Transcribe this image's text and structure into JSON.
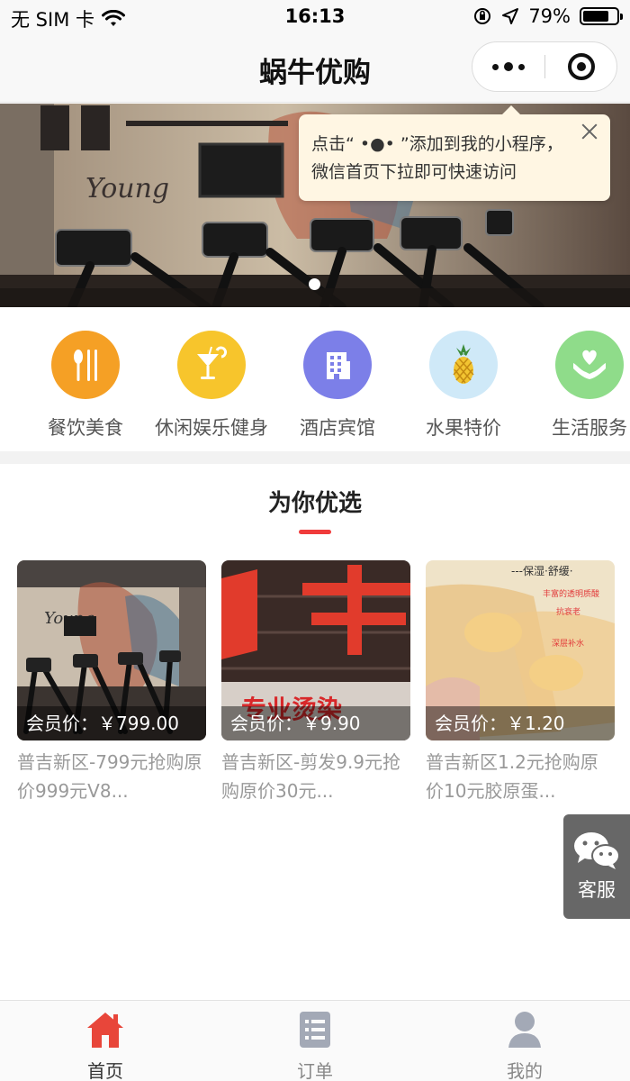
{
  "status_bar": {
    "carrier": "无 SIM 卡",
    "time": "16:13",
    "battery_text": "79%",
    "battery_level": 0.79
  },
  "nav": {
    "title": "蜗牛优购"
  },
  "banner": {
    "image": "gym-treadmills-photo",
    "slide_index": 1
  },
  "tooltip": {
    "line1": "点击“ •●• ”添加到我的小程序，",
    "line2": "微信首页下拉即可快速访问"
  },
  "categories": [
    {
      "label": "餐饮美食",
      "icon": "utensils-icon",
      "color": "#f5a025"
    },
    {
      "label": "休闲娱乐健身",
      "icon": "cocktail-icon",
      "color": "#f7c52c"
    },
    {
      "label": "酒店宾馆",
      "icon": "hotel-building-icon",
      "color": "#7c7fe8"
    },
    {
      "label": "水果特价",
      "icon": "pineapple-icon",
      "color": "#cfe9f8"
    },
    {
      "label": "生活服务",
      "icon": "heart-hands-icon",
      "color": "#8fdc8a"
    }
  ],
  "section": {
    "title": "为你优选",
    "accent": "#f03b3b"
  },
  "products": [
    {
      "price": "会员价：￥799.00",
      "title": "普吉新区-799元抢购原价999元V8..."
    },
    {
      "price": "会员价：￥9.90",
      "title": "普吉新区-剪发9.9元抢购原价30元..."
    },
    {
      "price": "会员价：￥1.20",
      "title": "普吉新区1.2元抢购原价10元胶原蛋..."
    }
  ],
  "service": {
    "label": "客服"
  },
  "tabs": [
    {
      "label": "首页",
      "icon": "home-icon",
      "active": true
    },
    {
      "label": "订单",
      "icon": "order-list-icon",
      "active": false
    },
    {
      "label": "我的",
      "icon": "user-icon",
      "active": false
    }
  ]
}
